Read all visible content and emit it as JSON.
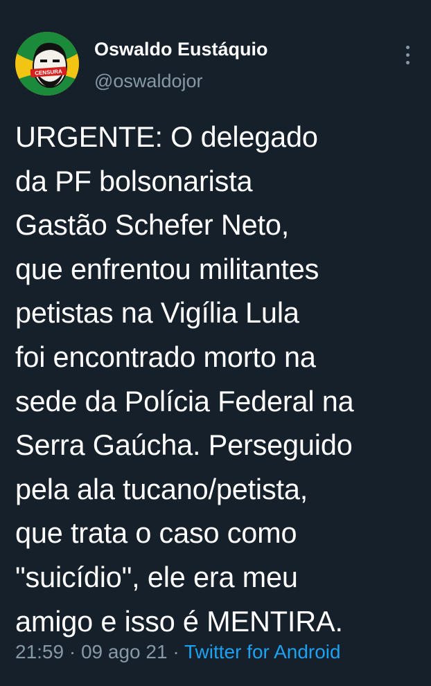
{
  "tweet": {
    "author_name": "Oswaldo Eustáquio",
    "author_handle": "@oswaldojor",
    "avatar_badge": "CENSURA",
    "text": "URGENTE: O delegado\nda PF bolsonarista\nGastão Schefer Neto,\nque enfrentou militantes\npetistas na Vigília Lula\nfoi encontrado morto na\nsede da Polícia Federal na\nSerra Gaúcha. Perseguido\npela ala tucano/petista,\nque trata o caso como\n\"suicídio\", ele era meu\namigo e isso é MENTIRA.",
    "time": "21:59",
    "separator": "·",
    "date": "09 ago 21",
    "source": "Twitter for Android"
  },
  "icons": {
    "more": "vertical-ellipsis-icon"
  },
  "colors": {
    "background": "#15202b",
    "primary_text": "#ffffff",
    "secondary_text": "#8899a6",
    "link": "#1da1f2"
  }
}
